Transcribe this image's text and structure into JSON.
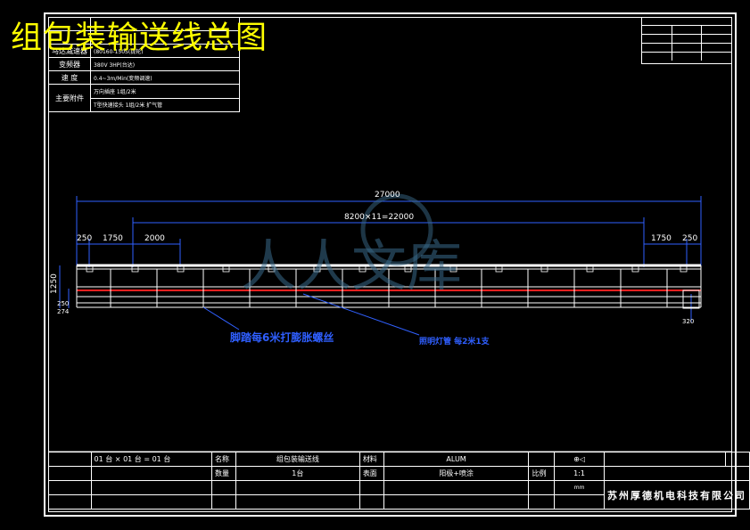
{
  "title": "组包装输送线总图",
  "spec_table": [
    {
      "key": "",
      "value": ""
    },
    {
      "key": "",
      "value": ""
    },
    {
      "key": "马达减速器",
      "value": "(80160-150S(拢轮)"
    },
    {
      "key": "变频器",
      "value": "380V 3HP(台达)"
    },
    {
      "key": "速 度",
      "value": "0.4~3m/Min(变频调速)"
    },
    {
      "key": "主要附件",
      "value": "万向插座 1组/2米"
    },
    {
      "key": "",
      "value": "T型快速接头 1组/2米 扩气管"
    }
  ],
  "dimensions": {
    "overall": "27000",
    "inner": "8200×11=22000",
    "left_end": "250",
    "left_a": "1750",
    "left_b": "2000",
    "right_a": "1750",
    "right_end": "250",
    "height_total": "1250",
    "height_a": "250",
    "height_b": "274",
    "right_height": "320"
  },
  "watermark": "人人文库",
  "notes": {
    "foot": "脚踏每6米打膨胀螺丝",
    "light": "照明灯管 每2米1支"
  },
  "title_block": {
    "r1": [
      "01",
      "台",
      "01",
      "台",
      "01",
      "台"
    ],
    "name_label": "名称",
    "name": "组包装输送线",
    "material_label": "材料",
    "material": "ALUM",
    "qty_label": "数量",
    "qty": "1台",
    "surface_label": "表面",
    "surface": "阳极+喷涂",
    "scale_label": "比例",
    "scale": "1:1",
    "unit": "mm",
    "company": "苏州厚德机电科技有限公司"
  }
}
